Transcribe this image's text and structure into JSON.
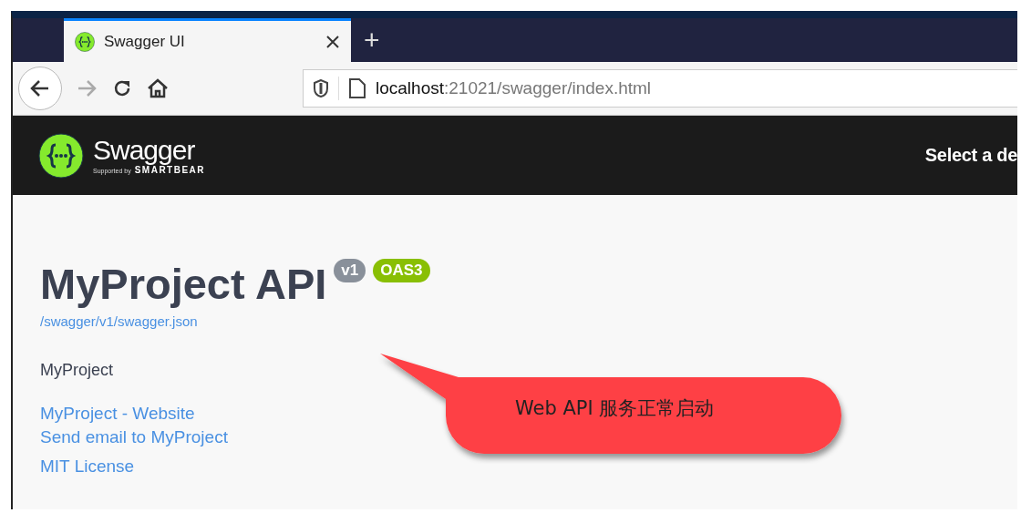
{
  "browser": {
    "tabs": [
      {
        "title": "Swagger UI",
        "selected": true
      }
    ],
    "new_tab": "+",
    "url": {
      "host": "localhost",
      "rest": ":21021/swagger/index.html"
    }
  },
  "header": {
    "brand": "Swagger",
    "supported_by": "Supported by",
    "company": "SMARTBEAR",
    "select_label": "Select a de"
  },
  "info": {
    "title": "MyProject API",
    "badges": [
      {
        "text": "v1",
        "color": "#89909a"
      },
      {
        "text": "OAS3",
        "color": "#89bf04"
      }
    ],
    "spec_link": "/swagger/v1/swagger.json",
    "description": "MyProject",
    "links": [
      "MyProject - Website",
      "Send email to MyProject"
    ],
    "license": "MIT License"
  },
  "callout": {
    "text": "Web API 服务正常启动"
  }
}
